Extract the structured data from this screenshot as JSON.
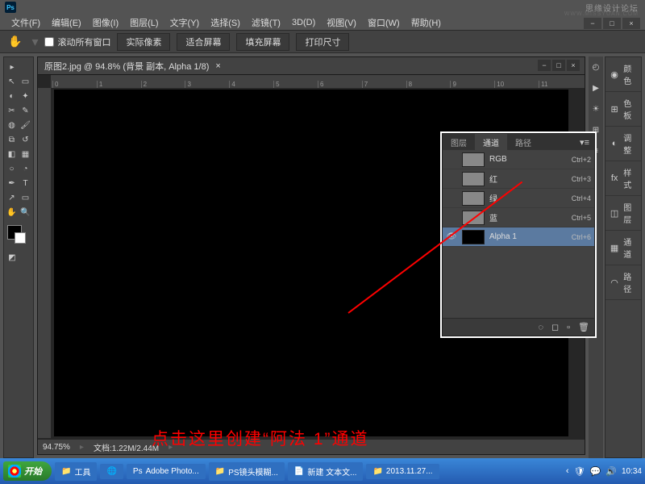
{
  "watermark": {
    "main": "思缘设计论坛",
    "sub": "WWW.MISSYUAN.COM"
  },
  "menus": [
    "文件(F)",
    "编辑(E)",
    "图像(I)",
    "图层(L)",
    "文字(Y)",
    "选择(S)",
    "滤镜(T)",
    "3D(D)",
    "视图(V)",
    "窗口(W)",
    "帮助(H)"
  ],
  "optbar": {
    "scroll_all": "滚动所有窗口",
    "actual": "实际像素",
    "fit": "适合屏幕",
    "fill": "填充屏幕",
    "print": "打印尺寸"
  },
  "doc": {
    "title": "原图2.jpg @ 94.8% (背景 副本, Alpha 1/8)",
    "zoom": "94.75%",
    "docinfo": "文档:1.22M/2.44M"
  },
  "ruler_marks": [
    "0",
    "1",
    "2",
    "3",
    "4",
    "5",
    "6",
    "7",
    "8",
    "9",
    "10",
    "11"
  ],
  "panel": {
    "tabs": [
      "图层",
      "通道",
      "路径"
    ],
    "channels": [
      {
        "name": "RGB",
        "shortcut": "Ctrl+2",
        "eye": false,
        "thumb": "img"
      },
      {
        "name": "红",
        "shortcut": "Ctrl+3",
        "eye": false,
        "thumb": "img"
      },
      {
        "name": "绿",
        "shortcut": "Ctrl+4",
        "eye": false,
        "thumb": "img"
      },
      {
        "name": "蓝",
        "shortcut": "Ctrl+5",
        "eye": false,
        "thumb": "img"
      },
      {
        "name": "Alpha 1",
        "shortcut": "Ctrl+6",
        "eye": true,
        "thumb": "black",
        "selected": true
      }
    ]
  },
  "right_panels": [
    "颜色",
    "色板",
    "调整",
    "样式",
    "图层",
    "通道",
    "路径"
  ],
  "annotation": "点击这里创建“阿法 1”通道",
  "taskbar": {
    "start": "开始",
    "items": [
      "工具",
      "",
      "Adobe Photo...",
      "PS镜头模糊...",
      "新建 文本文...",
      "2013.11.27..."
    ],
    "time": "10:34"
  }
}
